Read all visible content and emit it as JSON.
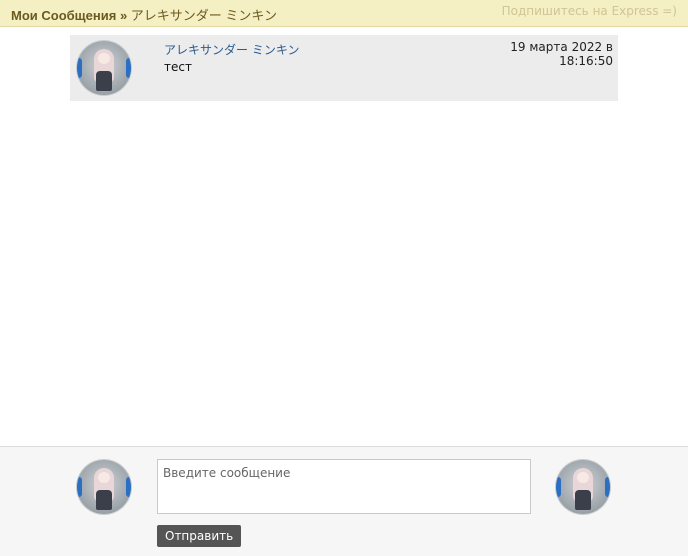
{
  "header": {
    "section_label": "Мои Сообщения",
    "separator": "»",
    "contact_name": "アレキサンダー ミンキン",
    "subscribe_link": "Подпишитесь на Express =)"
  },
  "messages": [
    {
      "author": "アレキサンダー ミンキン",
      "text": "тест",
      "date": "19 марта 2022 в",
      "time": "18:16:50"
    }
  ],
  "composer": {
    "placeholder": "Введите сообщение",
    "value": "",
    "send_label": "Отправить"
  },
  "colors": {
    "header_bg": "#f5efc4",
    "header_text": "#6b5a1e",
    "link": "#2d5a8e",
    "message_bg": "#ececec",
    "send_button_bg": "#555555"
  }
}
